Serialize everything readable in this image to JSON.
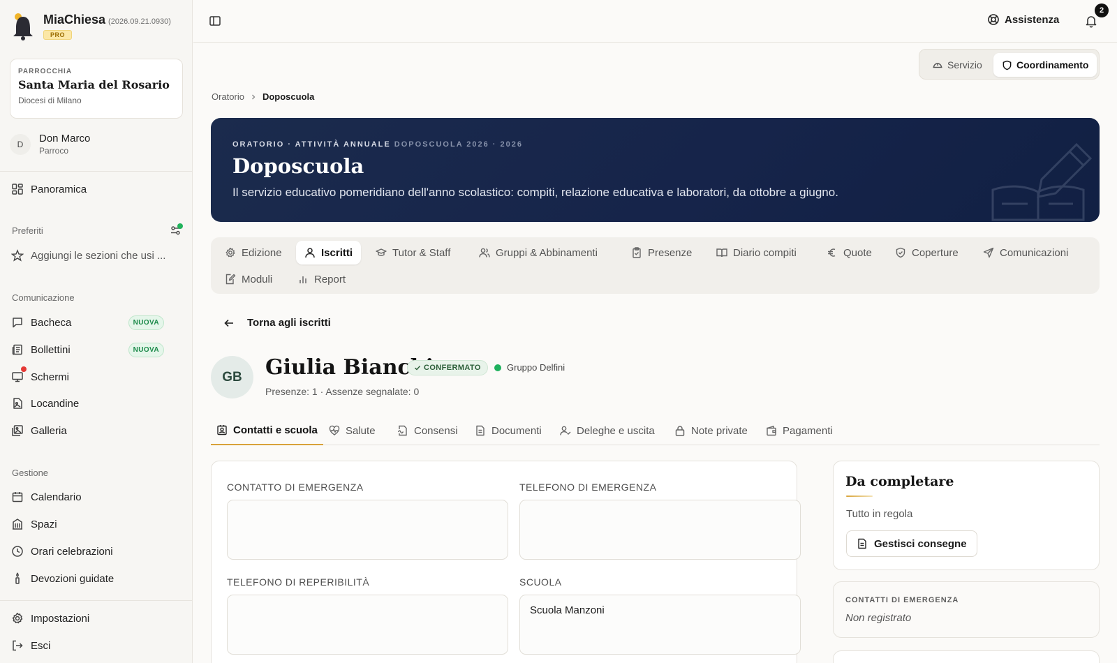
{
  "app": {
    "name": "MiaChiesa",
    "version": "(2026.09.21.0930)",
    "plan": "PRO"
  },
  "parish": {
    "kicker": "PARROCCHIA",
    "name": "Santa Maria del Rosario",
    "diocese": "Diocesi di Milano"
  },
  "user": {
    "initial": "D",
    "name": "Don Marco",
    "role": "Parroco"
  },
  "sidebar": {
    "overview": "Panoramica",
    "favorites": {
      "title": "Preferiti",
      "placeholder": "Aggiungi le sezioni che usi ..."
    },
    "communication": {
      "title": "Comunicazione",
      "items": [
        {
          "label": "Bacheca",
          "badge": "NUOVA"
        },
        {
          "label": "Bollettini",
          "badge": "NUOVA"
        },
        {
          "label": "Schermi"
        },
        {
          "label": "Locandine"
        },
        {
          "label": "Galleria"
        }
      ]
    },
    "management": {
      "title": "Gestione",
      "items": [
        {
          "label": "Calendario"
        },
        {
          "label": "Spazi"
        },
        {
          "label": "Orari celebrazioni"
        },
        {
          "label": "Devozioni guidate"
        }
      ]
    },
    "settings": "Impostazioni",
    "logout": "Esci"
  },
  "topbar": {
    "assist": "Assistenza",
    "notifications": "2"
  },
  "role_switch": {
    "service": "Servizio",
    "coordination": "Coordinamento"
  },
  "breadcrumb": {
    "parent": "Oratorio",
    "current": "Doposcuola"
  },
  "hero": {
    "kicker": "ORATORIO · ATTIVITÀ ANNUALE",
    "kicker_edition": "DOPOSCUOLA 2026 · 2026",
    "title": "Doposcuola",
    "subtitle": "Il servizio educativo pomeridiano dell'anno scolastico: compiti, relazione educativa e laboratori, da ottobre a giugno."
  },
  "section_tabs": [
    "Edizione",
    "Iscritti",
    "Tutor & Staff",
    "Gruppi & Abbinamenti",
    "Presenze",
    "Diario compiti",
    "Quote",
    "Coperture",
    "Comunicazioni",
    "Moduli",
    "Report"
  ],
  "back_label": "Torna agli iscritti",
  "person": {
    "initials": "GB",
    "name": "Giulia Bianchi",
    "status": "CONFERMATO",
    "group": "Gruppo Delfini",
    "stats": "Presenze: 1 · Assenze segnalate: 0"
  },
  "sub_tabs": [
    "Contatti e scuola",
    "Salute",
    "Consensi",
    "Documenti",
    "Deleghe e uscita",
    "Note private",
    "Pagamenti"
  ],
  "form": {
    "emergency_contact": {
      "label": "CONTATTO DI EMERGENZA",
      "value": ""
    },
    "emergency_phone": {
      "label": "TELEFONO DI EMERGENZA",
      "value": ""
    },
    "reach_phone": {
      "label": "TELEFONO DI REPERIBILITÀ",
      "value": ""
    },
    "school": {
      "label": "SCUOLA",
      "value": "Scuola Manzoni"
    }
  },
  "todo": {
    "title": "Da completare",
    "status": "Tutto in regola",
    "button": "Gestisci consegne"
  },
  "emergency_card": {
    "kicker": "CONTATTI DI EMERGENZA",
    "value": "Non registrato"
  },
  "colors": {
    "hero_bg": "#16244a",
    "accent": "#d8a23a",
    "success": "#1fb15e",
    "alert": "#e53935"
  }
}
